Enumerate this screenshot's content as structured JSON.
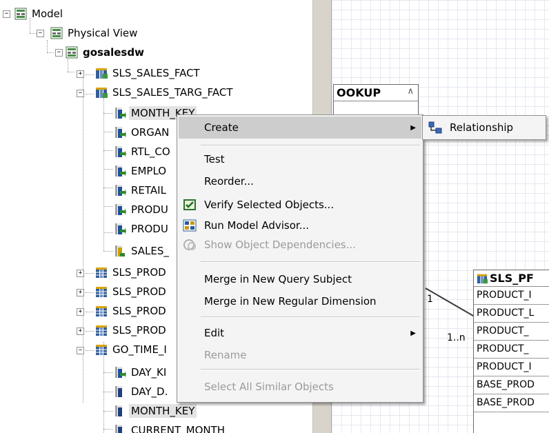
{
  "tree": {
    "model": "Model",
    "physical_view": "Physical View",
    "namespace": "gosalesdw",
    "items": [
      "SLS_SALES_FACT",
      "SLS_SALES_TARG_FACT",
      "MONTH_KEY",
      "ORGAN",
      "RTL_CO",
      "EMPLO",
      "RETAIL",
      "PRODU",
      "PRODU",
      "SALES_",
      "SLS_PROD",
      "SLS_PROD",
      "SLS_PROD",
      "SLS_PROD",
      "GO_TIME_I",
      "DAY_KI",
      "DAY_D.",
      "MONTH_KEY",
      "CURRENT_MONTH"
    ]
  },
  "canvas": {
    "lookup_title": "OOKUP",
    "sls_box_title": "SLS_PF",
    "sls_box_rows": [
      "PRODUCT_I",
      "PRODUCT_L",
      "PRODUCT_",
      "PRODUCT_",
      "PRODUCT_I",
      "BASE_PROD",
      "BASE_PROD"
    ],
    "card_1": "1",
    "card_1n": "1..n"
  },
  "context_menu": {
    "create": "Create",
    "test": "Test",
    "reorder": "Reorder...",
    "verify": "Verify Selected Objects...",
    "advisor": "Run Model Advisor...",
    "dependencies": "Show Object Dependencies...",
    "merge_query": "Merge in New Query Subject",
    "merge_dimension": "Merge in New Regular Dimension",
    "edit": "Edit",
    "rename": "Rename",
    "select_similar": "Select All Similar Objects"
  },
  "submenu": {
    "relationship": "Relationship"
  },
  "colors": {
    "menu_highlight": "#cdcdcd",
    "disabled_text": "#9a9a9a",
    "grid": "#e4e8f0"
  }
}
